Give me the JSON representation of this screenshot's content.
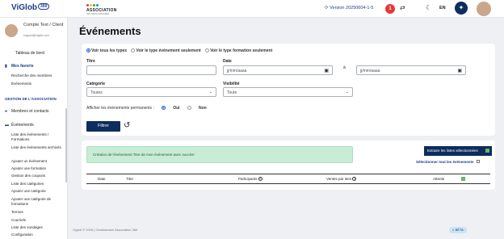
{
  "brand": {
    "logo": "ViGlob",
    "logo_badge": "360",
    "assoc_name": "ASSOCIATION",
    "assoc_sub": "DES GENS D'AFFAIRES"
  },
  "topbar": {
    "version": "Version 20250604-1-5",
    "notif_count": "1",
    "lang": "EN"
  },
  "user": {
    "name": "Compte Test / Client",
    "email": "support@viglob.com"
  },
  "sidebar": {
    "dashboard": "Tableau de bord",
    "favorites": "Mes favoris",
    "fav_items": [
      "Recherche des membres",
      "Événements"
    ],
    "section": "GESTION DE L'ASSOCIATION",
    "members": "Membres et contacts",
    "events": "Événements",
    "event_items": [
      "Liste des événements / Formations",
      "Liste des événements archivés",
      "Ajouter un événement",
      "Ajouter une formation",
      "Gestion des coupons",
      "Liste des catégories",
      "Ajouter une catégorie",
      "Ajouter une catégorie de formations",
      "Termes",
      "Courriels",
      "Liste des sondages",
      "Configuration"
    ]
  },
  "page": {
    "title": "Événements"
  },
  "filters": {
    "radio_options": [
      "Voir tous les types",
      "Voir le type événement seulement",
      "Voir le type formation seulement"
    ],
    "title_label": "Titre",
    "date_label": "Date",
    "date_from_placeholder": "jj/mm/aaaa",
    "date_to_placeholder": "jj/mm/aaaa",
    "date_sep": "à",
    "category_label": "Catégorie",
    "category_value": "Toutes",
    "visibility_label": "Visibilité",
    "visibility_value": "Toute",
    "permanent_label": "Afficher les événements permanents :",
    "yes": "Oui",
    "no": "Non",
    "filter_button": "Filtrer"
  },
  "list": {
    "success_msg": "Création de l'événement Titre de mon événement avec succès!",
    "extract_button": "Extraire les listes sélectionnées",
    "select_all": "Sélectionner tout les événements",
    "columns": [
      "Date",
      "Titre",
      "Participants",
      "Ventes par item",
      "Attente"
    ]
  },
  "footer": {
    "text": "Viglob © 2026 | Gestionnaire Association 360",
    "beta": "BÊTA"
  }
}
